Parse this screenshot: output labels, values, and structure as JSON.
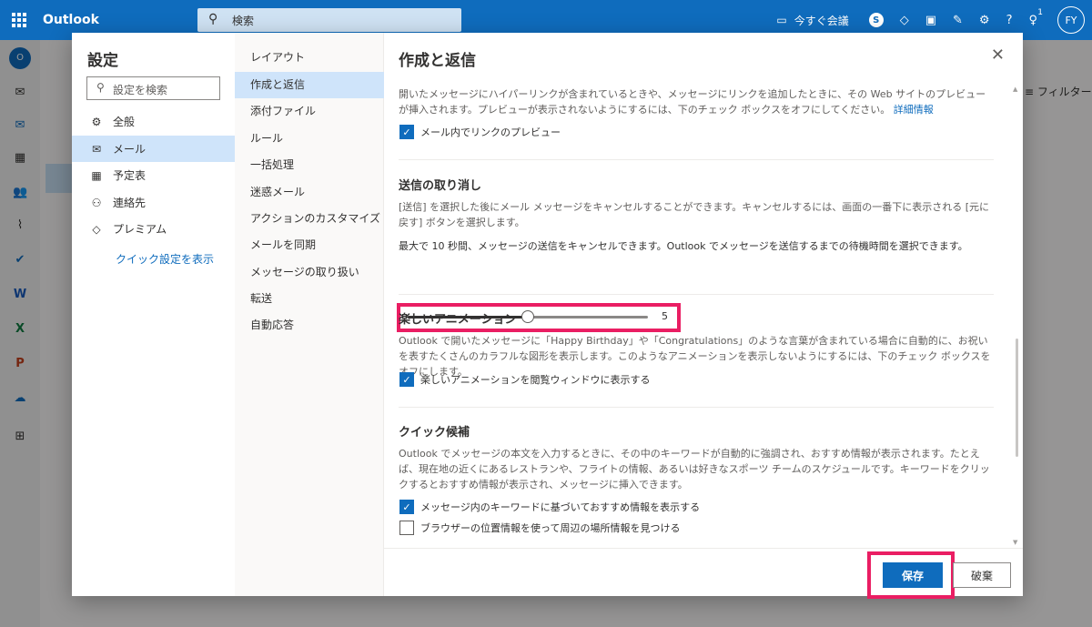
{
  "topbar": {
    "app_name": "Outlook",
    "search_placeholder": "検索",
    "meet_now": "今すぐ会議",
    "notification_count": "1",
    "avatar_initials": "FY"
  },
  "background": {
    "filter_label": "フィルター"
  },
  "settings": {
    "title": "設定",
    "search_placeholder": "設定を検索",
    "categories": [
      {
        "label": "全般",
        "icon": "gear-icon"
      },
      {
        "label": "メール",
        "icon": "mail-icon"
      },
      {
        "label": "予定表",
        "icon": "calendar-icon"
      },
      {
        "label": "連絡先",
        "icon": "people-icon"
      },
      {
        "label": "プレミアム",
        "icon": "diamond-icon"
      }
    ],
    "quick_settings": "クイック設定を表示",
    "subcategories": [
      "レイアウト",
      "作成と返信",
      "添付ファイル",
      "ルール",
      "一括処理",
      "迷惑メール",
      "アクションのカスタマイズ",
      "メールを同期",
      "メッセージの取り扱い",
      "転送",
      "自動応答"
    ]
  },
  "content": {
    "title": "作成と返信",
    "link_preview": {
      "description": "開いたメッセージにハイパーリンクが含まれているときや、メッセージにリンクを追加したときに、その Web サイトのプレビューが挿入されます。プレビューが表示されないようにするには、下のチェック ボックスをオフにしてください。",
      "more_info": "詳細情報",
      "checkbox_label": "メール内でリンクのプレビュー"
    },
    "undo_send": {
      "heading": "送信の取り消し",
      "description": "[送信] を選択した後にメール メッセージをキャンセルすることができます。キャンセルするには、画面の一番下に表示される [元に戻す] ボタンを選択します。",
      "slider_label": "最大で 10 秒間、メッセージの送信をキャンセルできます。Outlook でメッセージを送信するまでの待機時間を選択できます。",
      "value": "5",
      "max": 10
    },
    "animations": {
      "heading": "楽しいアニメーション",
      "description": "Outlook で開いたメッセージに「Happy Birthday」や「Congratulations」のような言葉が含まれている場合に自動的に、お祝いを表すたくさんのカラフルな図形を表示します。このようなアニメーションを表示しないようにするには、下のチェック ボックスをオフにします。",
      "checkbox_label": "楽しいアニメーションを閲覧ウィンドウに表示する"
    },
    "suggestions": {
      "heading": "クイック候補",
      "description": "Outlook でメッセージの本文を入力するときに、その中のキーワードが自動的に強調され、おすすめ情報が表示されます。たとえば、現在地の近くにあるレストランや、フライトの情報、あるいは好きなスポーツ チームのスケジュールです。キーワードをクリックするとおすすめ情報が表示され、メッセージに挿入できます。",
      "checkbox1_label": "メッセージ内のキーワードに基づいておすすめ情報を表示する",
      "checkbox2_label": "ブラウザーの位置情報を使って周辺の場所情報を見つける"
    }
  },
  "footer": {
    "save": "保存",
    "discard": "破棄"
  },
  "colors": {
    "accent": "#0f6cbd",
    "highlight": "#ea1e63",
    "selected": "#cfe4fa"
  }
}
